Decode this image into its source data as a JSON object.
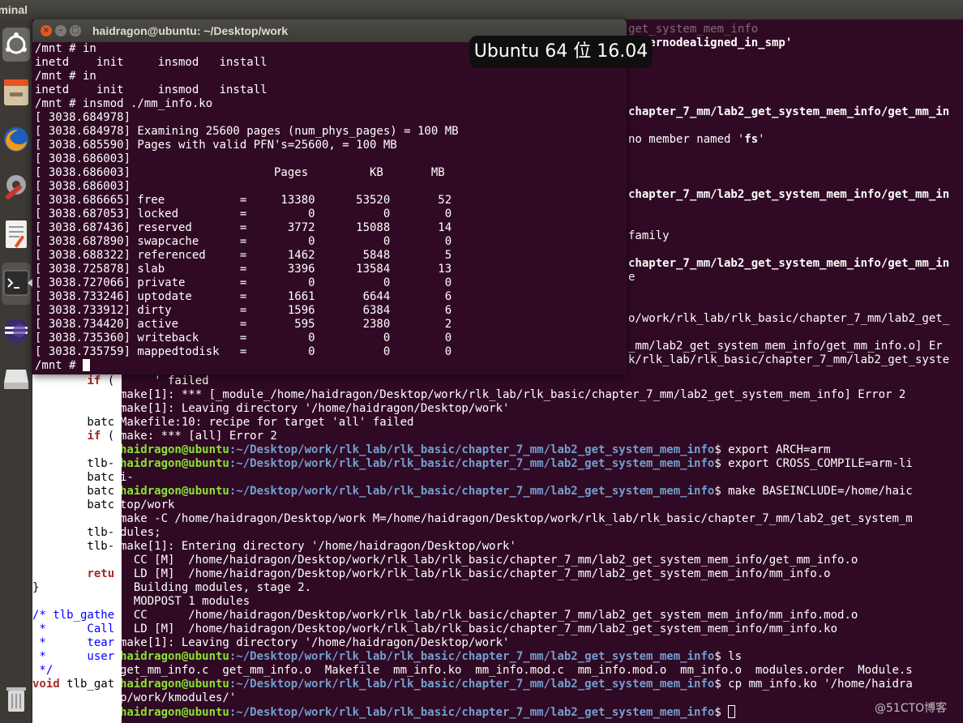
{
  "topbar": {
    "app_name": "rminal"
  },
  "launcher": {
    "items": [
      {
        "icon": "ubuntu-logo-icon"
      },
      {
        "icon": "files-icon"
      },
      {
        "icon": "firefox-icon"
      },
      {
        "icon": "settings-icon"
      },
      {
        "icon": "text-editor-icon"
      },
      {
        "icon": "terminal-icon"
      },
      {
        "icon": "eclipse-icon"
      },
      {
        "icon": "drive-icon"
      },
      {
        "icon": "trash-icon"
      }
    ]
  },
  "overlay": {
    "text": "Ubuntu 64 位 16.04"
  },
  "watermark": {
    "text": "@51CTO博客"
  },
  "window": {
    "title": "haidragon@ubuntu: ~/Desktop/work",
    "close": "×",
    "minimize": "–",
    "maximize": "□",
    "lines": [
      "/mnt # in",
      "inetd    init     insmod   install",
      "/mnt # in",
      "inetd    init     insmod   install",
      "/mnt # insmod ./mm_info.ko",
      "[ 3038.684978]",
      "[ 3038.684978] Examining 25600 pages (num_phys_pages) = 100 MB",
      "[ 3038.685590] Pages with valid PFN's=25600, = 100 MB",
      "[ 3038.686003]",
      "[ 3038.686003]                     Pages         KB       MB",
      "[ 3038.686003]",
      "[ 3038.686665] free           =     13380      53520       52",
      "[ 3038.687053] locked         =         0          0        0",
      "[ 3038.687436] reserved       =      3772      15088       14",
      "[ 3038.687890] swapcache      =         0          0        0",
      "[ 3038.688322] referenced     =      1462       5848        5",
      "[ 3038.725878] slab           =      3396      13584       13",
      "[ 3038.727066] private        =         0          0        0",
      "[ 3038.733246] uptodate       =      1661       6644        6",
      "[ 3038.733912] dirty          =      1596       6384        6",
      "[ 3038.734420] active         =       595       2380        2",
      "[ 3038.735360] writeback      =         0          0        0",
      "[ 3038.735759] mappedtodisk   =         0          0        0"
    ],
    "last_prompt": "/mnt # "
  },
  "editor": {
    "lines": [
      {
        "kind": "code",
        "text": "        if (",
        "kw": "if"
      },
      {
        "kind": "code",
        "text": ""
      },
      {
        "kind": "code",
        "text": ""
      },
      {
        "kind": "code",
        "text": "        batc"
      },
      {
        "kind": "code",
        "text": "        if (",
        "kw": "if"
      },
      {
        "kind": "code",
        "text": ""
      },
      {
        "kind": "code",
        "text": "        tlb-"
      },
      {
        "kind": "code",
        "text": "        batc"
      },
      {
        "kind": "code",
        "text": "        batc"
      },
      {
        "kind": "code",
        "text": "        batc"
      },
      {
        "kind": "code",
        "text": ""
      },
      {
        "kind": "code",
        "text": "        tlb-"
      },
      {
        "kind": "code",
        "text": "        tlb-"
      },
      {
        "kind": "code",
        "text": ""
      },
      {
        "kind": "code",
        "text": "        retu",
        "kw": "retu"
      },
      {
        "kind": "code",
        "text": "}"
      },
      {
        "kind": "code",
        "text": ""
      },
      {
        "kind": "comment",
        "text": "/* tlb_gathe"
      },
      {
        "kind": "comment",
        "text": " *      Call"
      },
      {
        "kind": "comment",
        "text": " *      tear"
      },
      {
        "kind": "comment",
        "text": " *      user"
      },
      {
        "kind": "comment",
        "text": " */"
      },
      {
        "kind": "code",
        "text": "void tlb_gat",
        "kw": "void"
      }
    ]
  },
  "bgterm": {
    "right_fragments": [
      {
        "row": 0,
        "text": "get_system_mem_info",
        "gray": true
      },
      {
        "row": 1,
        "text": "internodealigned_in_smp'",
        "bold": true
      },
      {
        "row": 6,
        "text": "chapter_7_mm/lab2_get_system_mem_info/get_mm_in",
        "bold": true
      },
      {
        "row": 8,
        "text": "no member named 'fs'",
        "boldword": "fs"
      },
      {
        "row": 12,
        "text": "chapter_7_mm/lab2_get_system_mem_info/get_mm_in",
        "bold": true
      },
      {
        "row": 15,
        "text": "family"
      },
      {
        "row": 17,
        "text": "chapter_7_mm/lab2_get_system_mem_info/get_mm_in",
        "bold": true
      },
      {
        "row": 18,
        "text": "e"
      },
      {
        "row": 21,
        "text": "o/work/rlk_lab/rlk_basic/chapter_7_mm/lab2_get_"
      },
      {
        "row": 23,
        "text": "_mm/lab2_get_system_mem_info/get_mm_info.o] Er"
      },
      {
        "row": 24,
        "text": "k/rlk_lab/rlk_basic/chapter_7_mm/lab2_get_syste"
      }
    ],
    "lines": [
      {
        "type": "plain",
        "text": "' failed",
        "indent": "     "
      },
      {
        "type": "plain",
        "text": "make[1]: *** [_module_/home/haidragon/Desktop/work/rlk_lab/rlk_basic/chapter_7_mm/lab2_get_system_mem_info] Error 2"
      },
      {
        "type": "plain",
        "text": "make[1]: Leaving directory '/home/haidragon/Desktop/work'"
      },
      {
        "type": "plain",
        "text": "Makefile:10: recipe for target 'all' failed"
      },
      {
        "type": "plain",
        "text": "make: *** [all] Error 2"
      },
      {
        "type": "prompt",
        "user": "haidragon@ubuntu",
        "path": ":~/Desktop/work/rlk_lab/rlk_basic/chapter_7_mm/lab2_get_system_mem_info",
        "cmd": "$ export ARCH=arm"
      },
      {
        "type": "prompt",
        "user": "haidragon@ubuntu",
        "path": ":~/Desktop/work/rlk_lab/rlk_basic/chapter_7_mm/lab2_get_system_mem_info",
        "cmd": "$ export CROSS_COMPILE=arm-li"
      },
      {
        "type": "plain",
        "text": "i-"
      },
      {
        "type": "prompt",
        "user": "haidragon@ubuntu",
        "path": ":~/Desktop/work/rlk_lab/rlk_basic/chapter_7_mm/lab2_get_system_mem_info",
        "cmd": "$ make BASEINCLUDE=/home/haic"
      },
      {
        "type": "plain",
        "text": "top/work"
      },
      {
        "type": "plain",
        "text": "make -C /home/haidragon/Desktop/work M=/home/haidragon/Desktop/work/rlk_lab/rlk_basic/chapter_7_mm/lab2_get_system_m"
      },
      {
        "type": "plain",
        "text": "dules;"
      },
      {
        "type": "plain",
        "text": "make[1]: Entering directory '/home/haidragon/Desktop/work'"
      },
      {
        "type": "plain",
        "text": "  CC [M]  /home/haidragon/Desktop/work/rlk_lab/rlk_basic/chapter_7_mm/lab2_get_system_mem_info/get_mm_info.o"
      },
      {
        "type": "plain",
        "text": "  LD [M]  /home/haidragon/Desktop/work/rlk_lab/rlk_basic/chapter_7_mm/lab2_get_system_mem_info/mm_info.o"
      },
      {
        "type": "plain",
        "text": "  Building modules, stage 2."
      },
      {
        "type": "plain",
        "text": "  MODPOST 1 modules"
      },
      {
        "type": "plain",
        "text": "  CC      /home/haidragon/Desktop/work/rlk_lab/rlk_basic/chapter_7_mm/lab2_get_system_mem_info/mm_info.mod.o"
      },
      {
        "type": "plain",
        "text": "  LD [M]  /home/haidragon/Desktop/work/rlk_lab/rlk_basic/chapter_7_mm/lab2_get_system_mem_info/mm_info.ko"
      },
      {
        "type": "plain",
        "text": "make[1]: Leaving directory '/home/haidragon/Desktop/work'"
      },
      {
        "type": "prompt",
        "user": "haidragon@ubuntu",
        "path": ":~/Desktop/work/rlk_lab/rlk_basic/chapter_7_mm/lab2_get_system_mem_info",
        "cmd": "$ ls"
      },
      {
        "type": "plain",
        "text": "get_mm_info.c  get_mm_info.o  Makefile  mm_info.ko  mm_info.mod.c  mm_info.mod.o  mm_info.o  modules.order  Module.s"
      },
      {
        "type": "prompt",
        "user": "haidragon@ubuntu",
        "path": ":~/Desktop/work/rlk_lab/rlk_basic/chapter_7_mm/lab2_get_system_mem_info",
        "cmd": "$ cp mm_info.ko '/home/haidra"
      },
      {
        "type": "plain",
        "text": "p/work/kmodules/'"
      },
      {
        "type": "prompt",
        "user": "haidragon@ubuntu",
        "path": ":~/Desktop/work/rlk_lab/rlk_basic/chapter_7_mm/lab2_get_system_mem_info",
        "cmd": "$ ",
        "cursor": true
      }
    ]
  }
}
